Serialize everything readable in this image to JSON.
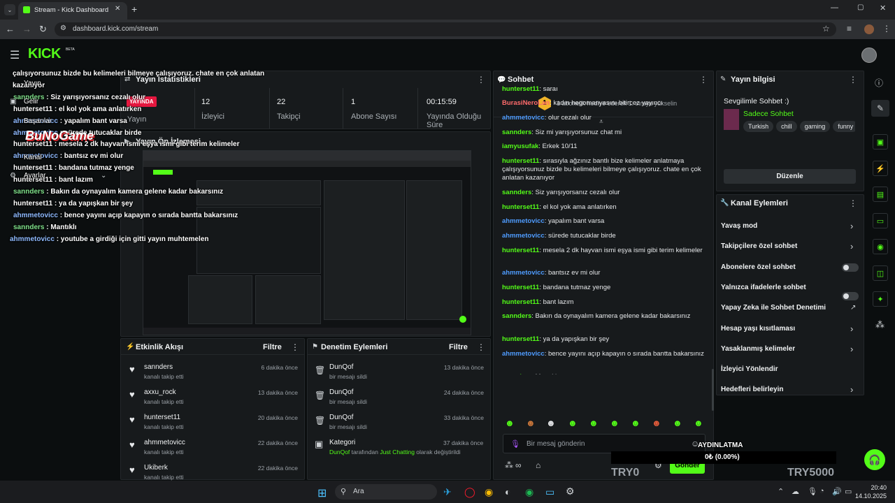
{
  "browser": {
    "tab_title": "Stream - Kick Dashboard",
    "url": "dashboard.kick.com/stream"
  },
  "header": {
    "logo": "KICK",
    "logo_badge": "BETA"
  },
  "overlay": {
    "lines": [
      {
        "user": "",
        "text": "çalışıyorsunuz bizde bu kelimeleri bilmeye çalışıyoruz. chate en çok anlatan"
      },
      {
        "user": "",
        "text": "kazanıyor"
      },
      {
        "user": "sannders",
        "text": " : Siz yarışıyorsanız cezalı olur"
      },
      {
        "user": "hunterset11",
        "text": " : el kol yok ama anlatırken"
      },
      {
        "user": "ahmmetovicc",
        "text": " : yapalım bant varsa"
      },
      {
        "user": "ahmmetovicc",
        "text": " : sürede tutucaklar birde"
      },
      {
        "user": "hunterset11",
        "text": " : mesela 2 dk hayvan ismi eşya ismi gibi terim kelimeler"
      },
      {
        "user": "ahmmetovicc",
        "text": " : bantsız ev mi olur"
      },
      {
        "user": "hunterset11",
        "text": " : bandana tutmaz yenge"
      },
      {
        "user": "hunterset11",
        "text": " : bant lazım"
      },
      {
        "user": "sannders",
        "text": " : Bakın da oynayalım kamera gelene kadar bakarsınız"
      },
      {
        "user": "hunterset11",
        "text": " : ya da yapışkan bir şey"
      },
      {
        "user": "ahmmetovicc",
        "text": " : bence yayını açıp kapayın o sırada bantta bakarsınız"
      },
      {
        "user": "sannders",
        "text": " : Mantıklı"
      },
      {
        "user": "ahmmetovicc",
        "text": " : youtube a girdiği için gitti yayın muhtemelen"
      }
    ],
    "nav_items": [
      "Yayın",
      "Gelir",
      "Başarılar",
      "Kanal",
      "Ayarlar"
    ],
    "brand": "BuNoGame"
  },
  "stats": {
    "title": "Yayın İstatistikleri",
    "live_badge": "YAYINDA",
    "live_label": "Yayın",
    "items": [
      {
        "value": "12",
        "label": "İzleyici"
      },
      {
        "value": "22",
        "label": "Takipçi"
      },
      {
        "value": "1",
        "label": "Abone Sayısı"
      },
      {
        "value": "00:15:59",
        "label": "Yayında Olduğu Süre"
      }
    ]
  },
  "preview": {
    "title": "Yayın Ön İzlemesi"
  },
  "activity": {
    "title": "Etkinlik Akışı",
    "filter": "Filtre",
    "items": [
      {
        "name": "sannders",
        "sub": "kanalı takip etti",
        "time": "6 dakika önce"
      },
      {
        "name": "axxu_rock",
        "sub": "kanalı takip etti",
        "time": "13 dakika önce"
      },
      {
        "name": "hunterset11",
        "sub": "kanalı takip etti",
        "time": "20 dakika önce"
      },
      {
        "name": "ahmmetovicc",
        "sub": "kanalı takip etti",
        "time": "22 dakika önce"
      },
      {
        "name": "Ukiberk",
        "sub": "kanalı takip etti",
        "time": "22 dakika önce"
      }
    ]
  },
  "moderation": {
    "title": "Denetim Eylemleri",
    "filter": "Filtre",
    "items": [
      {
        "name": "DunQof",
        "sub": "bir mesajı sildi",
        "time": "13 dakika önce"
      },
      {
        "name": "DunQof",
        "sub": "bir mesajı sildi",
        "time": "24 dakika önce"
      },
      {
        "name": "DunQof",
        "sub": "bir mesajı sildi",
        "time": "33 dakika önce"
      }
    ],
    "category": {
      "name": "Kategori",
      "time": "37 dakika önce",
      "actor": "DunQof",
      "mid": " tarafından ",
      "game": "Just Chatting",
      "end": " olarak değiştirildi"
    }
  },
  "chat": {
    "title": "Sohbet",
    "gift_badge": "1",
    "gift_text": "1 abonelik hediye ederek 1. sıraya yükselin",
    "messages": [
      {
        "user": "hunterset11",
        "color": "g",
        "text": ": saraı"
      },
      {
        "user": "BurasiNeroLan",
        "color": "r",
        "text": ": kadın hegomanyasını bitircez yayıncı"
      },
      {
        "user": "ahmmetovicc",
        "color": "b",
        "text": ": olur cezalı olur"
      },
      {
        "user": "sannders",
        "color": "g",
        "text": ": Siz mi yarışıyorsunuz chat mi"
      },
      {
        "user": "iamyusufak",
        "color": "g",
        "text": ": Erkek 10/11"
      },
      {
        "user": "hunterset11",
        "color": "g",
        "text": ": sırasıyla ağzınız bantlı bize kelimeler anlatmaya çalışıyorsunuz bizde bu kelimeleri bilmeye çalışıyoruz. chate en çok anlatan kazanıyor"
      },
      {
        "user": "sannders",
        "color": "g",
        "text": ": Siz yarışıyorsanız cezalı olur"
      },
      {
        "user": "hunterset11",
        "color": "g",
        "text": ": el kol yok ama anlatırken"
      },
      {
        "user": "ahmmetovicc",
        "color": "b",
        "text": ": yapalım bant varsa"
      },
      {
        "user": "ahmmetovicc",
        "color": "b",
        "text": ": sürede tutucaklar birde"
      },
      {
        "user": "hunterset11",
        "color": "g",
        "text": ": mesela 2 dk hayvan ismi eşya ismi gibi terim kelimeler"
      },
      {
        "user": "ahmmetovicc",
        "color": "b",
        "text": ": bantsız ev mi olur"
      },
      {
        "user": "hunterset11",
        "color": "g",
        "text": ": bandana tutmaz yenge"
      },
      {
        "user": "hunterset11",
        "color": "g",
        "text": ": bant lazım"
      },
      {
        "user": "sannders",
        "color": "g",
        "text": ": Bakın da oynayalım kamera gelene kadar bakarsınız"
      },
      {
        "user": "hunterset11",
        "color": "g",
        "text": ": ya da yapışkan bir şey"
      },
      {
        "user": "ahmmetovicc",
        "color": "b",
        "text": ": bence yayını açıp kapayın o sırada bantta bakarsınız"
      },
      {
        "user": "sannders",
        "color": "g",
        "text": ": Mantıklı"
      },
      {
        "user": "ahmmetovicc",
        "color": "b",
        "text": ": youtube a girdiği için gitti yayın muhtemelen"
      }
    ],
    "input_placeholder": "Bir mesaj gönderin",
    "send_label": "Gönder"
  },
  "stream_info": {
    "title": "Yayın bilgisi",
    "stream_title": "Sevgilimle Sohbet :)",
    "category": "Sadece Sohbet",
    "tags": [
      "Turkish",
      "chill",
      "gaming",
      "funny"
    ],
    "edit_label": "Düzenle"
  },
  "channel_actions": {
    "title": "Kanal Eylemleri",
    "items": [
      {
        "label": "Yavaş mod",
        "control": "chevron"
      },
      {
        "label": "Takipçilere özel sohbet",
        "control": "chevron"
      },
      {
        "label": "Abonelere özel sohbet",
        "control": "toggle"
      },
      {
        "label": "Yalnızca ifadelerle sohbet",
        "control": "toggle"
      },
      {
        "label": "Yapay Zeka ile Sohbet Denetimi",
        "control": "external"
      },
      {
        "label": "Hesap yaşı kısıtlaması",
        "control": "chevron"
      },
      {
        "label": "Yasaklanmış kelimeler",
        "control": "chevron"
      },
      {
        "label": "İzleyici Yönlendir",
        "control": "none"
      },
      {
        "label": "Hedefleri belirleyin",
        "control": "chevron"
      }
    ]
  },
  "goal_overlay": {
    "label": "AYDINLATMA",
    "progress": "0₺ (0.00%)",
    "progress_fraction": 0,
    "min": "TRY0",
    "max": "TRY5000"
  },
  "taskbar": {
    "search": "Ara",
    "time": "20:40",
    "date": "14.10.2025"
  },
  "colors": {
    "accent": "#53fc18",
    "live": "#e5173f",
    "panel": "#171a1c"
  }
}
